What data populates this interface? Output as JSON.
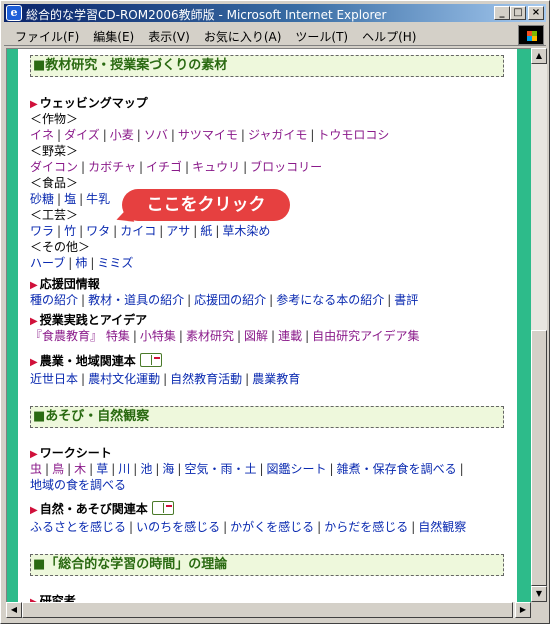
{
  "window": {
    "title": "総合的な学習CD-ROM2006教師版 - Microsoft Internet Explorer",
    "icon": "ie-icon",
    "controls": {
      "minimize": "_",
      "maximize": "□",
      "close": "×"
    }
  },
  "menu": [
    "ファイル(F)",
    "編集(E)",
    "表示(V)",
    "お気に入り(A)",
    "ツール(T)",
    "ヘルプ(H)"
  ],
  "sections": {
    "materials": {
      "heading": "■教材研究・授業案づくりの素材",
      "webbing": {
        "title": "ウェッビングマップ",
        "crops_label": "＜作物＞",
        "crops": [
          "イネ",
          "ダイズ",
          "小麦",
          "ソバ",
          "サツマイモ",
          "ジャガイモ",
          "トウモロコシ"
        ],
        "veg_label": "＜野菜＞",
        "vegetables": [
          "ダイコン",
          "カボチャ",
          "イチゴ",
          "キュウリ",
          "ブロッコリー"
        ],
        "food_label": "＜食品＞",
        "foods": [
          "砂糖",
          "塩",
          "牛乳"
        ],
        "craft_label": "＜工芸＞",
        "crafts": [
          "ワラ",
          "竹",
          "ワタ",
          "カイコ",
          "アサ",
          "紙",
          "草木染め"
        ],
        "other_label": "＜その他＞",
        "others": [
          "ハーブ",
          "柿",
          "ミミズ"
        ]
      },
      "support": {
        "title": "応援団情報",
        "links": [
          "種の紹介",
          "教材・道具の紹介",
          "応援団の紹介",
          "参考になる本の紹介",
          "書評"
        ]
      },
      "practice": {
        "title": "授業実践とアイデア",
        "links": [
          "『食農教育』 特集",
          "小特集",
          "素材研究",
          "図解",
          "連載",
          "自由研究アイデア集"
        ]
      },
      "agri": {
        "title": "農業・地域関連本",
        "links": [
          "近世日本",
          "農村文化運動",
          "自然教育活動",
          "農業教育"
        ]
      }
    },
    "play": {
      "heading": "■あそび・自然観察",
      "worksheet": {
        "title": "ワークシート",
        "links": [
          "虫",
          "鳥",
          "木",
          "草",
          "川",
          "池",
          "海",
          "空気・雨・土",
          "図鑑シート",
          "雑煮・保存食を調べる",
          "地域の食を調べる"
        ]
      },
      "nature": {
        "title": "自然・あそび関連本",
        "links": [
          "ふるさとを感じる",
          "いのちを感じる",
          "かがくを感じる",
          "からだを感じる",
          "自然観察"
        ]
      }
    },
    "theory": {
      "heading": "■「総合的な学習の時間」の理論",
      "partial": "研究者"
    }
  },
  "callout": {
    "text": "ここをクリック",
    "color": "#e64040"
  },
  "colors": {
    "accent_green": "#2dbb8a",
    "visited_link": "#8a1a8a",
    "link": "#0a2ab0",
    "heading_text": "#2a6a12"
  }
}
